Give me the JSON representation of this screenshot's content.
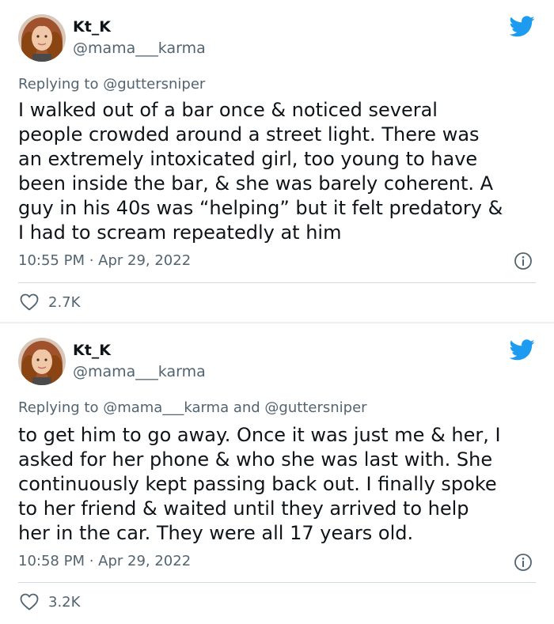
{
  "tweets": [
    {
      "display_name": "Kt_K",
      "handle": "@mama___karma",
      "reply_prefix": "Replying to ",
      "reply_to": "@guttersniper",
      "body_lines": [
        "I walked out of a bar once & noticed several",
        "people crowded around a street light. There was",
        "an extremely intoxicated girl, too young to have",
        "been inside the bar, & she was barely coherent. A",
        "guy in his 40s was “helping” but it felt predatory &",
        "I had to scream repeatedly at him"
      ],
      "timestamp": "10:55 PM · Apr 29, 2022",
      "likes": "2.7K"
    },
    {
      "display_name": "Kt_K",
      "handle": "@mama___karma",
      "reply_prefix": "Replying to ",
      "reply_to": "@mama___karma and @guttersniper",
      "body_lines": [
        "to get him to go away. Once it was just me & her, I",
        "asked for her phone & who she was last with. She",
        "continuously kept passing back out. I finally spoke",
        "to her friend & waited until they arrived to help",
        "her in the car. They were all 17 years old."
      ],
      "timestamp": "10:58 PM · Apr 29, 2022",
      "likes": "3.2K"
    }
  ],
  "colors": {
    "twitter_blue": "#1d9bf0",
    "secondary_text": "#536471",
    "primary_text": "#0f1419",
    "divider": "#cfd9de"
  },
  "icons": {
    "brand": "twitter-bird-icon",
    "info": "info-icon",
    "like": "heart-icon"
  }
}
